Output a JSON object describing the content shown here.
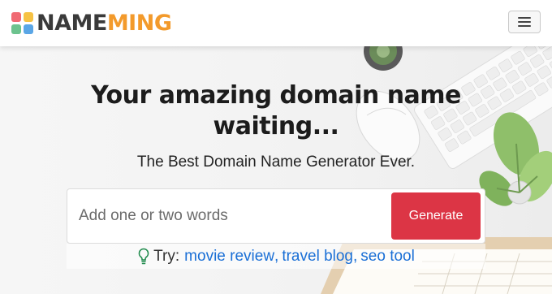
{
  "brand": {
    "name_part1": "NAME",
    "name_part2": "MING",
    "colors": {
      "name": "#3a3a3a",
      "ming": "#f39a2b",
      "squares": [
        "#f06a73",
        "#f6c244",
        "#6cc38e",
        "#5aa6e6"
      ]
    }
  },
  "navbar": {
    "menu_icon": "hamburger-icon"
  },
  "hero": {
    "headline": "Your amazing domain name waiting...",
    "subheadline": "The Best Domain Name Generator Ever."
  },
  "search": {
    "placeholder": "Add one or two words",
    "button_label": "Generate",
    "button_color": "#dc3545"
  },
  "suggestions": {
    "icon": "lightbulb-icon",
    "label": "Try:",
    "items": [
      "movie review",
      "travel blog",
      "seo tool"
    ],
    "link_color": "#1a6fd6"
  }
}
